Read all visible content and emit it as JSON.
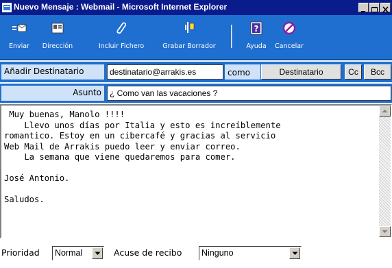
{
  "window": {
    "title": "Nuevo Mensaje : Webmail - Microsoft Internet Explorer"
  },
  "toolbar": {
    "buttons": [
      {
        "label": "Enviar",
        "icon": "send-icon"
      },
      {
        "label": "Dirección",
        "icon": "address-book-icon"
      },
      {
        "label": "Incluir Fichero",
        "icon": "paperclip-icon"
      },
      {
        "label": "Grabar Borrador",
        "icon": "save-draft-icon"
      },
      {
        "label": "Ayuda",
        "icon": "help-icon"
      },
      {
        "label": "Cancelar",
        "icon": "cancel-icon"
      }
    ]
  },
  "compose": {
    "add_recipient_label": "Añadir Destinatario",
    "recipient_value": "destinatario@arrakis.es",
    "como_label": "como",
    "destinatario_button": "Destinatario",
    "cc_button": "Cc",
    "bcc_button": "Bcc",
    "subject_label": "Asunto",
    "subject_value": "¿ Como van las vacaciones ?",
    "body": " Muy buenas, Manolo !!!!\n    Llevo unos días por Italia y esto es increíblemente\nromantico. Estoy en un cibercafé y gracias al servicio\nWeb Mail de Arrakis puedo leer y enviar correo.\n    La semana que viene quedaremos para comer.\n\nJosé Antonio.\n\nSaludos."
  },
  "footer": {
    "priority_label": "Prioridad",
    "priority_value": "Normal",
    "receipt_label": "Acuse de recibo",
    "receipt_value": "Ninguno"
  },
  "colors": {
    "titlebar": "#0a1c8c",
    "toolbar": "#1f6fd0",
    "label_cell": "#cfe2f8"
  }
}
